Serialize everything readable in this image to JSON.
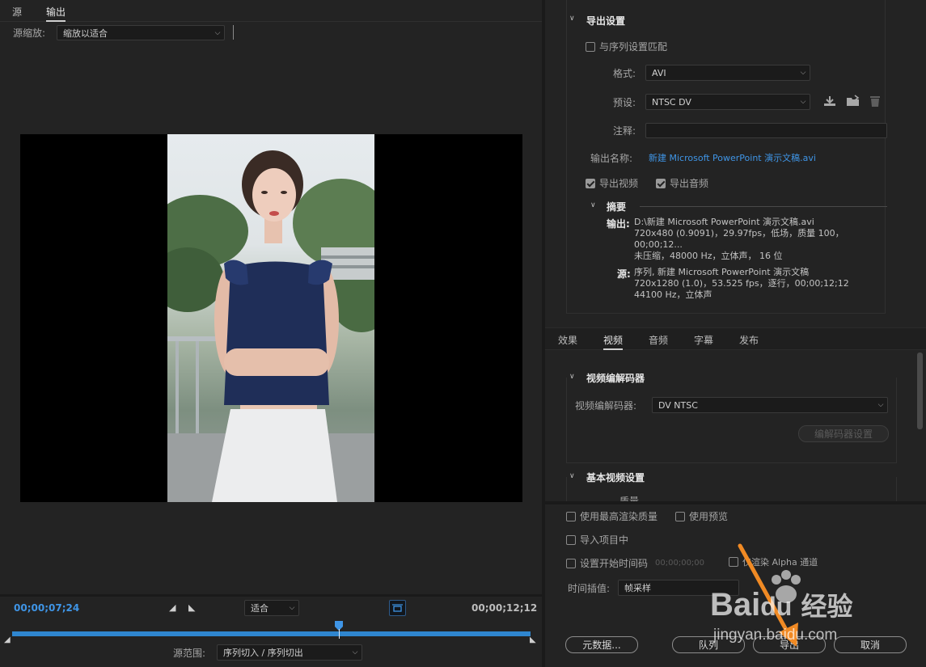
{
  "left": {
    "tabs": [
      {
        "label": "源"
      },
      {
        "label": "输出"
      }
    ],
    "source_scale": {
      "label": "源缩放:",
      "value": "缩放以适合"
    },
    "timecode_current": "00;00;07;24",
    "timecode_end": "00;00;12;12",
    "fit_select": "适合",
    "source_range": {
      "label": "源范围:",
      "value": "序列切入 / 序列切出"
    },
    "playhead_fraction": 0.63
  },
  "export_settings": {
    "title": "导出设置",
    "match_sequence": {
      "label": "与序列设置匹配",
      "checked": false
    },
    "format": {
      "label": "格式:",
      "value": "AVI"
    },
    "preset": {
      "label": "预设:",
      "value": "NTSC DV"
    },
    "comment": {
      "label": "注释:",
      "value": ""
    },
    "output_name": {
      "label": "输出名称:",
      "value": "新建 Microsoft PowerPoint 演示文稿.avi"
    },
    "export_video": {
      "label": "导出视频",
      "checked": true
    },
    "export_audio": {
      "label": "导出音频",
      "checked": true
    },
    "summary": {
      "title": "摘要",
      "output_label": "输出:",
      "output_lines": [
        "D:\\新建 Microsoft PowerPoint 演示文稿.avi",
        "720x480 (0.9091)，29.97fps，低场，质量 100，00;00;12...",
        "未压缩，48000 Hz，立体声， 16 位"
      ],
      "source_label": "源:",
      "source_lines": [
        "序列, 新建 Microsoft PowerPoint 演示文稿",
        "720x1280 (1.0)，53.525 fps，逐行，00;00;12;12",
        "44100 Hz，立体声"
      ]
    }
  },
  "settings_tabs": [
    {
      "label": "效果"
    },
    {
      "label": "视频"
    },
    {
      "label": "音频"
    },
    {
      "label": "字幕"
    },
    {
      "label": "发布"
    }
  ],
  "video_codec": {
    "title": "视频编解码器",
    "codec_label": "视频编解码器:",
    "codec_value": "DV NTSC",
    "codec_settings_button": "编解码器设置"
  },
  "basic_video": {
    "title": "基本视频设置",
    "partial_label": "质量"
  },
  "bottom": {
    "max_render_quality": "使用最高渲染质量",
    "use_previews": "使用预览",
    "import_into_project": "导入项目中",
    "set_start_timecode": "设置开始时间码",
    "start_timecode_value": "00;00;00;00",
    "render_alpha": "仅渲染 Alpha 通道",
    "time_interpolation": {
      "label": "时间插值:",
      "value": "帧采样"
    },
    "metadata_button": "元数据...",
    "queue_button": "队列",
    "export_button": "导出",
    "cancel_button": "取消"
  },
  "watermark": {
    "brand": "Bai",
    "brand2": "du",
    "cn": "经验",
    "url": "jingyan.baidu.com"
  },
  "colors": {
    "accent": "#3f95e6",
    "arrow": "#f08a24"
  }
}
